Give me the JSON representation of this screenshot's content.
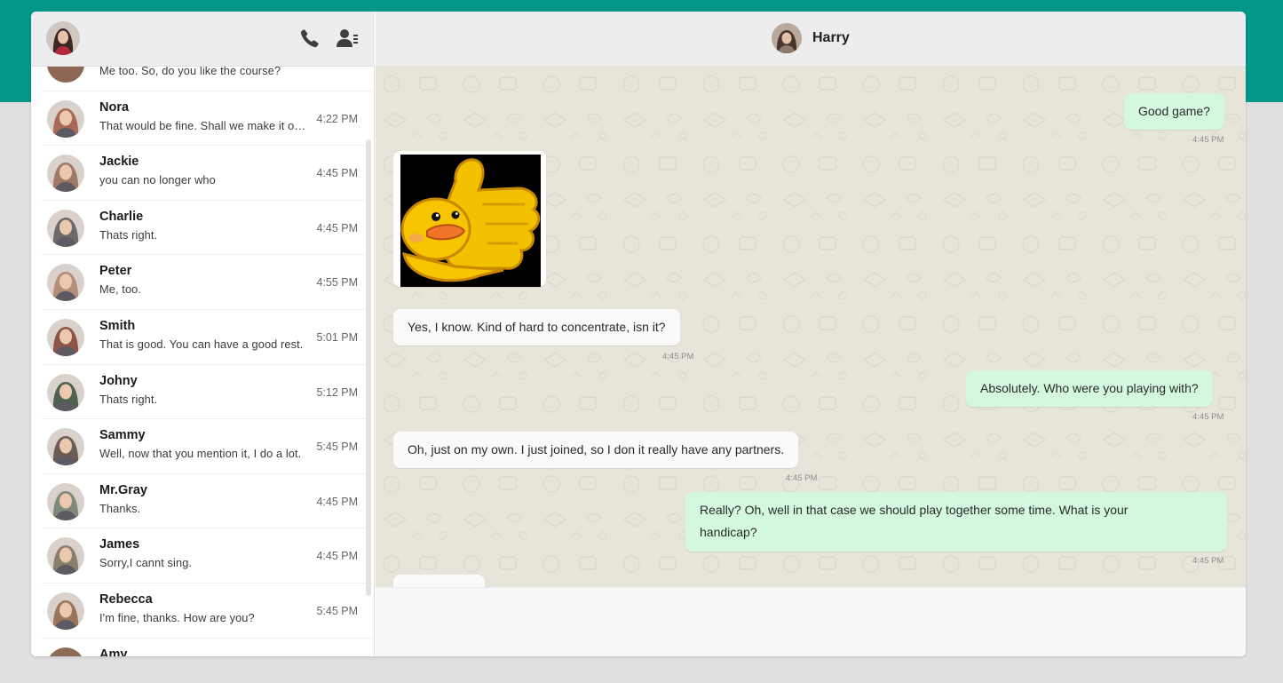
{
  "header": {
    "contact_name": "Harry"
  },
  "sidebar": {
    "partial_top_preview": "Me too. So, do you like the course?",
    "partial_bottom_name": "Amy",
    "chats": [
      {
        "name": "Nora",
        "preview": "That would be fine. Shall we make it on Saturday?",
        "time": "4:22 PM",
        "avatar_color": "#a86a57"
      },
      {
        "name": "Jackie",
        "preview": "you can no longer who",
        "time": "4:45 PM",
        "avatar_color": "#9f7a68"
      },
      {
        "name": "Charlie",
        "preview": "Thats right.",
        "time": "4:45 PM",
        "avatar_color": "#6d6a69"
      },
      {
        "name": "Peter",
        "preview": "Me, too.",
        "time": "4:55 PM",
        "avatar_color": "#b48e7b"
      },
      {
        "name": "Smith",
        "preview": "That is good. You can have a good rest.",
        "time": "5:01 PM",
        "avatar_color": "#8d5546"
      },
      {
        "name": "Johny",
        "preview": "Thats right.",
        "time": "5:12 PM",
        "avatar_color": "#4d6350"
      },
      {
        "name": "Sammy",
        "preview": "Well, now that you mention it, I do a lot.",
        "time": "5:45 PM",
        "avatar_color": "#6b5c55"
      },
      {
        "name": "Mr.Gray",
        "preview": "Thanks.",
        "time": "4:45 PM",
        "avatar_color": "#7d8a7a"
      },
      {
        "name": "James",
        "preview": "Sorry,I cannt sing.",
        "time": "4:45 PM",
        "avatar_color": "#8a7f6c"
      },
      {
        "name": "Rebecca",
        "preview": "I'm fine, thanks. How are you?",
        "time": "5:45 PM",
        "avatar_color": "#9a7559"
      }
    ]
  },
  "messages": [
    {
      "direction": "out",
      "text": "Good game?",
      "time": "4:45 PM"
    },
    {
      "direction": "in",
      "type": "sticker",
      "sticker": "thumbs-up-duck-sticker"
    },
    {
      "direction": "in",
      "text": "Yes, I know. Kind of hard to concentrate, isn it?",
      "time": "4:45 PM"
    },
    {
      "direction": "out",
      "text": "Absolutely. Who were you playing with?",
      "time": "4:45 PM"
    },
    {
      "direction": "in",
      "text": "Oh, just on my own. I just joined, so I don it really have any partners.",
      "time": "4:45 PM"
    },
    {
      "direction": "out",
      "text_line1": "Really? Oh, well in that case we should play together some time. What is your",
      "text_line2": "handicap?",
      "time": "4:45 PM"
    }
  ],
  "colors": {
    "brand_band": "#029789",
    "outgoing_bubble": "#d3f8dd",
    "incoming_bubble": "#fafafa",
    "chat_background": "#e7e4da"
  }
}
